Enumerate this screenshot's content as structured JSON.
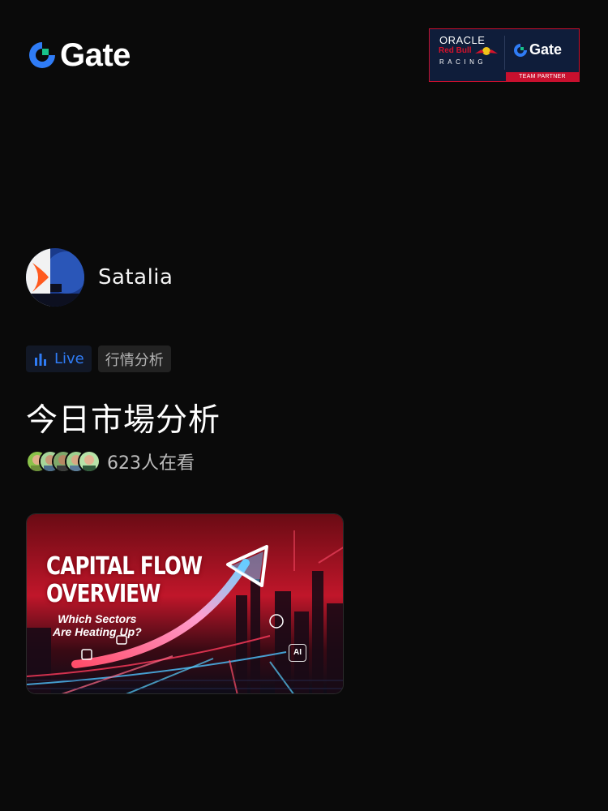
{
  "brand": {
    "name": "Gate",
    "accent": "#2f7cf6"
  },
  "partner_badge": {
    "oracle": "ORACLE",
    "redbull": "Red Bull",
    "racing": "RACING",
    "brand": "Gate",
    "ribbon": "TEAM PARTNER"
  },
  "host": {
    "name": "Satalia"
  },
  "tags": {
    "live": "Live",
    "category": "行情分析"
  },
  "stream": {
    "title": "今日市場分析",
    "viewers": "623人在看"
  },
  "thumbnail": {
    "title_line1": "CAPITAL FLOW",
    "title_line2": "OVERVIEW",
    "subtitle_line1": "Which Sectors",
    "subtitle_line2": "Are Heating Up?",
    "badge": "AI"
  },
  "icons": [
    "gate-logo-icon",
    "bar-chart-icon",
    "bull-icon"
  ]
}
